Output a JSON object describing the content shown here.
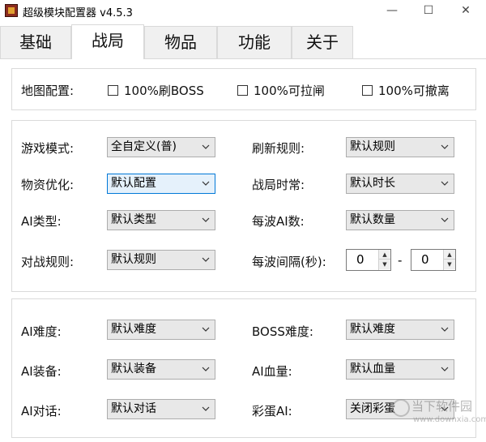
{
  "window": {
    "title": "超级模块配置器 v4.5.3",
    "min": "—",
    "max": "☐",
    "close": "✕"
  },
  "tabs": [
    {
      "label": "基础",
      "active": false
    },
    {
      "label": "战局",
      "active": true
    },
    {
      "label": "物品",
      "active": false
    },
    {
      "label": "功能",
      "active": false
    },
    {
      "label": "关于",
      "active": false
    }
  ],
  "map_config": {
    "label": "地图配置:",
    "options": [
      {
        "label": "100%刷BOSS",
        "checked": false
      },
      {
        "label": "100%可拉闸",
        "checked": false
      },
      {
        "label": "100%可撤离",
        "checked": false
      }
    ]
  },
  "mode_panel": {
    "game_mode": {
      "label": "游戏模式:",
      "value": "全自定义(普)"
    },
    "refresh_rule": {
      "label": "刷新规则:",
      "value": "默认规则"
    },
    "loot_opt": {
      "label": "物资优化:",
      "value": "默认配置"
    },
    "match_duration": {
      "label": "战局时常:",
      "value": "默认时长"
    },
    "ai_type": {
      "label": "AI类型:",
      "value": "默认类型"
    },
    "wave_ai_count": {
      "label": "每波AI数:",
      "value": "默认数量"
    },
    "battle_rule": {
      "label": "对战规则:",
      "value": "默认规则"
    },
    "wave_interval": {
      "label": "每波间隔(秒):",
      "from": "0",
      "to": "0",
      "separator": "-"
    }
  },
  "ai_panel": {
    "ai_difficulty": {
      "label": "AI难度:",
      "value": "默认难度"
    },
    "boss_difficulty": {
      "label": "BOSS难度:",
      "value": "默认难度"
    },
    "ai_equipment": {
      "label": "AI装备:",
      "value": "默认装备"
    },
    "ai_health": {
      "label": "AI血量:",
      "value": "默认血量"
    },
    "ai_dialogue": {
      "label": "AI对话:",
      "value": "默认对话"
    },
    "easter_egg_ai": {
      "label": "彩蛋AI:",
      "value": "关闭彩蛋"
    }
  },
  "watermark": {
    "text": "当下软件园",
    "url": "www.downxia.com"
  }
}
